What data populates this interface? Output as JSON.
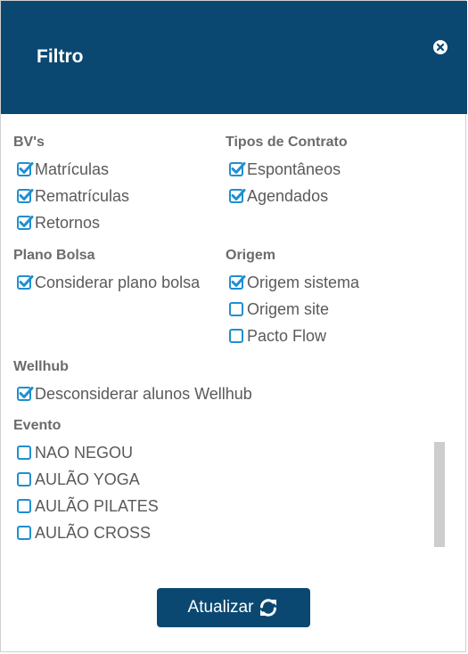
{
  "header": {
    "title": "Filtro",
    "close_icon": "close-icon"
  },
  "sections": {
    "bvs": {
      "label": "BV's",
      "items": [
        {
          "label": "Matrículas",
          "checked": true
        },
        {
          "label": "Rematrículas",
          "checked": true
        },
        {
          "label": "Retornos",
          "checked": true
        }
      ]
    },
    "tipos_contrato": {
      "label": "Tipos de Contrato",
      "items": [
        {
          "label": "Espontâneos",
          "checked": true
        },
        {
          "label": "Agendados",
          "checked": true
        }
      ]
    },
    "plano_bolsa": {
      "label": "Plano Bolsa",
      "items": [
        {
          "label": "Considerar plano bolsa",
          "checked": true
        }
      ]
    },
    "origem": {
      "label": "Origem",
      "items": [
        {
          "label": "Origem sistema",
          "checked": true
        },
        {
          "label": "Origem site",
          "checked": false
        },
        {
          "label": "Pacto Flow",
          "checked": false
        }
      ]
    },
    "wellhub": {
      "label": "Wellhub",
      "items": [
        {
          "label": "Desconsiderar alunos Wellhub",
          "checked": true
        }
      ]
    },
    "evento": {
      "label": "Evento",
      "items": [
        {
          "label": "NAO NEGOU",
          "checked": false
        },
        {
          "label": "AULÃO YOGA",
          "checked": false
        },
        {
          "label": "AULÃO PILATES",
          "checked": false
        },
        {
          "label": "AULÃO CROSS",
          "checked": false
        }
      ]
    }
  },
  "footer": {
    "update_label": "Atualizar",
    "update_icon": "refresh-icon"
  },
  "colors": {
    "header_bg": "#0b4871",
    "checkbox": "#1f8fd1",
    "button_bg": "#0b4871"
  }
}
